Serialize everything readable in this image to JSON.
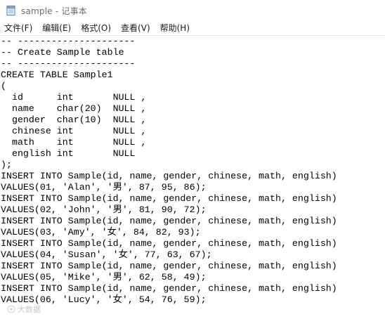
{
  "window": {
    "title": "sample - 记事本"
  },
  "menu": [
    {
      "label": "文件(F)"
    },
    {
      "label": "编辑(E)"
    },
    {
      "label": "格式(O)"
    },
    {
      "label": "查看(V)"
    },
    {
      "label": "帮助(H)"
    }
  ],
  "editor": {
    "lines": [
      "-- ---------------------",
      "-- Create Sample table",
      "-- ---------------------",
      "CREATE TABLE Sample1",
      "(",
      "  id      int       NULL ,",
      "  name    char(20)  NULL ,",
      "  gender  char(10)  NULL ,",
      "  chinese int       NULL ,",
      "  math    int       NULL ,",
      "  english int       NULL",
      ");",
      "INSERT INTO Sample(id, name, gender, chinese, math, english)",
      "VALUES(01, 'Alan', '男', 87, 95, 86);",
      "INSERT INTO Sample(id, name, gender, chinese, math, english)",
      "VALUES(02, 'John', '男', 81, 90, 72);",
      "INSERT INTO Sample(id, name, gender, chinese, math, english)",
      "VALUES(03, 'Amy', '女', 84, 82, 93);",
      "INSERT INTO Sample(id, name, gender, chinese, math, english)",
      "VALUES(04, 'Susan', '女', 77, 63, 67);",
      "INSERT INTO Sample(id, name, gender, chinese, math, english)",
      "VALUES(05, 'Mike', '男', 62, 58, 49);",
      "INSERT INTO Sample(id, name, gender, chinese, math, english)",
      "VALUES(06, 'Lucy', '女', 54, 76, 59);"
    ]
  },
  "watermark": {
    "text": "大数据"
  }
}
